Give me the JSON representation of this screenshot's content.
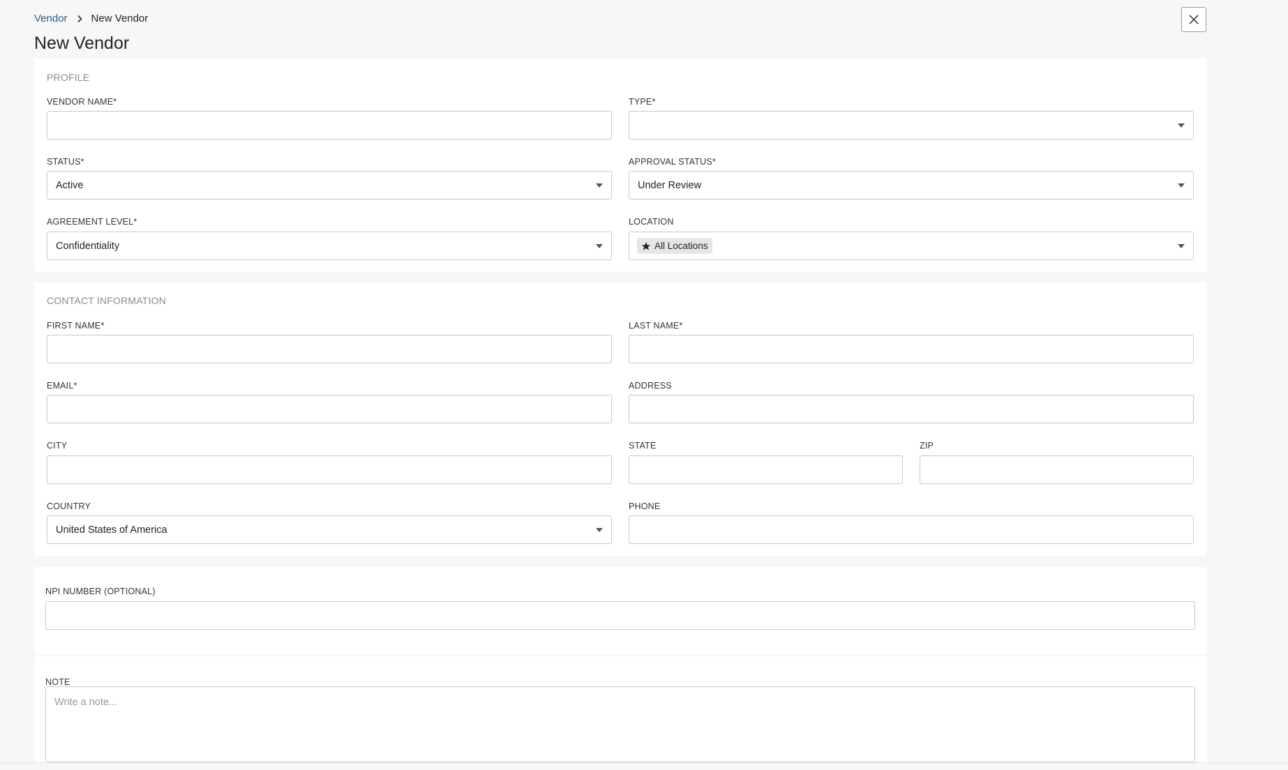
{
  "breadcrumb": {
    "parent": "Vendor",
    "current": "New Vendor"
  },
  "page_title": "New Vendor",
  "icons": {
    "close": "close-icon",
    "chevron": "chevron-right-icon",
    "star": "star-icon",
    "caret": "caret-down-icon"
  },
  "profile": {
    "title": "PROFILE",
    "vendor_name": {
      "label": "VENDOR NAME*",
      "value": ""
    },
    "type": {
      "label": "TYPE*",
      "value": ""
    },
    "status": {
      "label": "STATUS*",
      "value": "Active"
    },
    "approval_status": {
      "label": "APPROVAL STATUS*",
      "value": "Under Review"
    },
    "agreement_level": {
      "label": "AGREEMENT LEVEL*",
      "value": "Confidentiality"
    },
    "location": {
      "label": "LOCATION",
      "chip": "All Locations"
    }
  },
  "contact": {
    "title": "CONTACT INFORMATION",
    "first_name": {
      "label": "FIRST NAME*",
      "value": ""
    },
    "last_name": {
      "label": "LAST NAME*",
      "value": ""
    },
    "email": {
      "label": "EMAIL*",
      "value": ""
    },
    "address": {
      "label": "ADDRESS",
      "value": ""
    },
    "city": {
      "label": "CITY",
      "value": ""
    },
    "state": {
      "label": "STATE",
      "value": ""
    },
    "zip": {
      "label": "ZIP",
      "value": ""
    },
    "country": {
      "label": "COUNTRY",
      "value": "United States of America"
    },
    "phone": {
      "label": "PHONE",
      "value": ""
    }
  },
  "npi": {
    "label": "NPI NUMBER (OPTIONAL)",
    "value": ""
  },
  "note": {
    "label": "NOTE",
    "placeholder": "Write a note..."
  }
}
